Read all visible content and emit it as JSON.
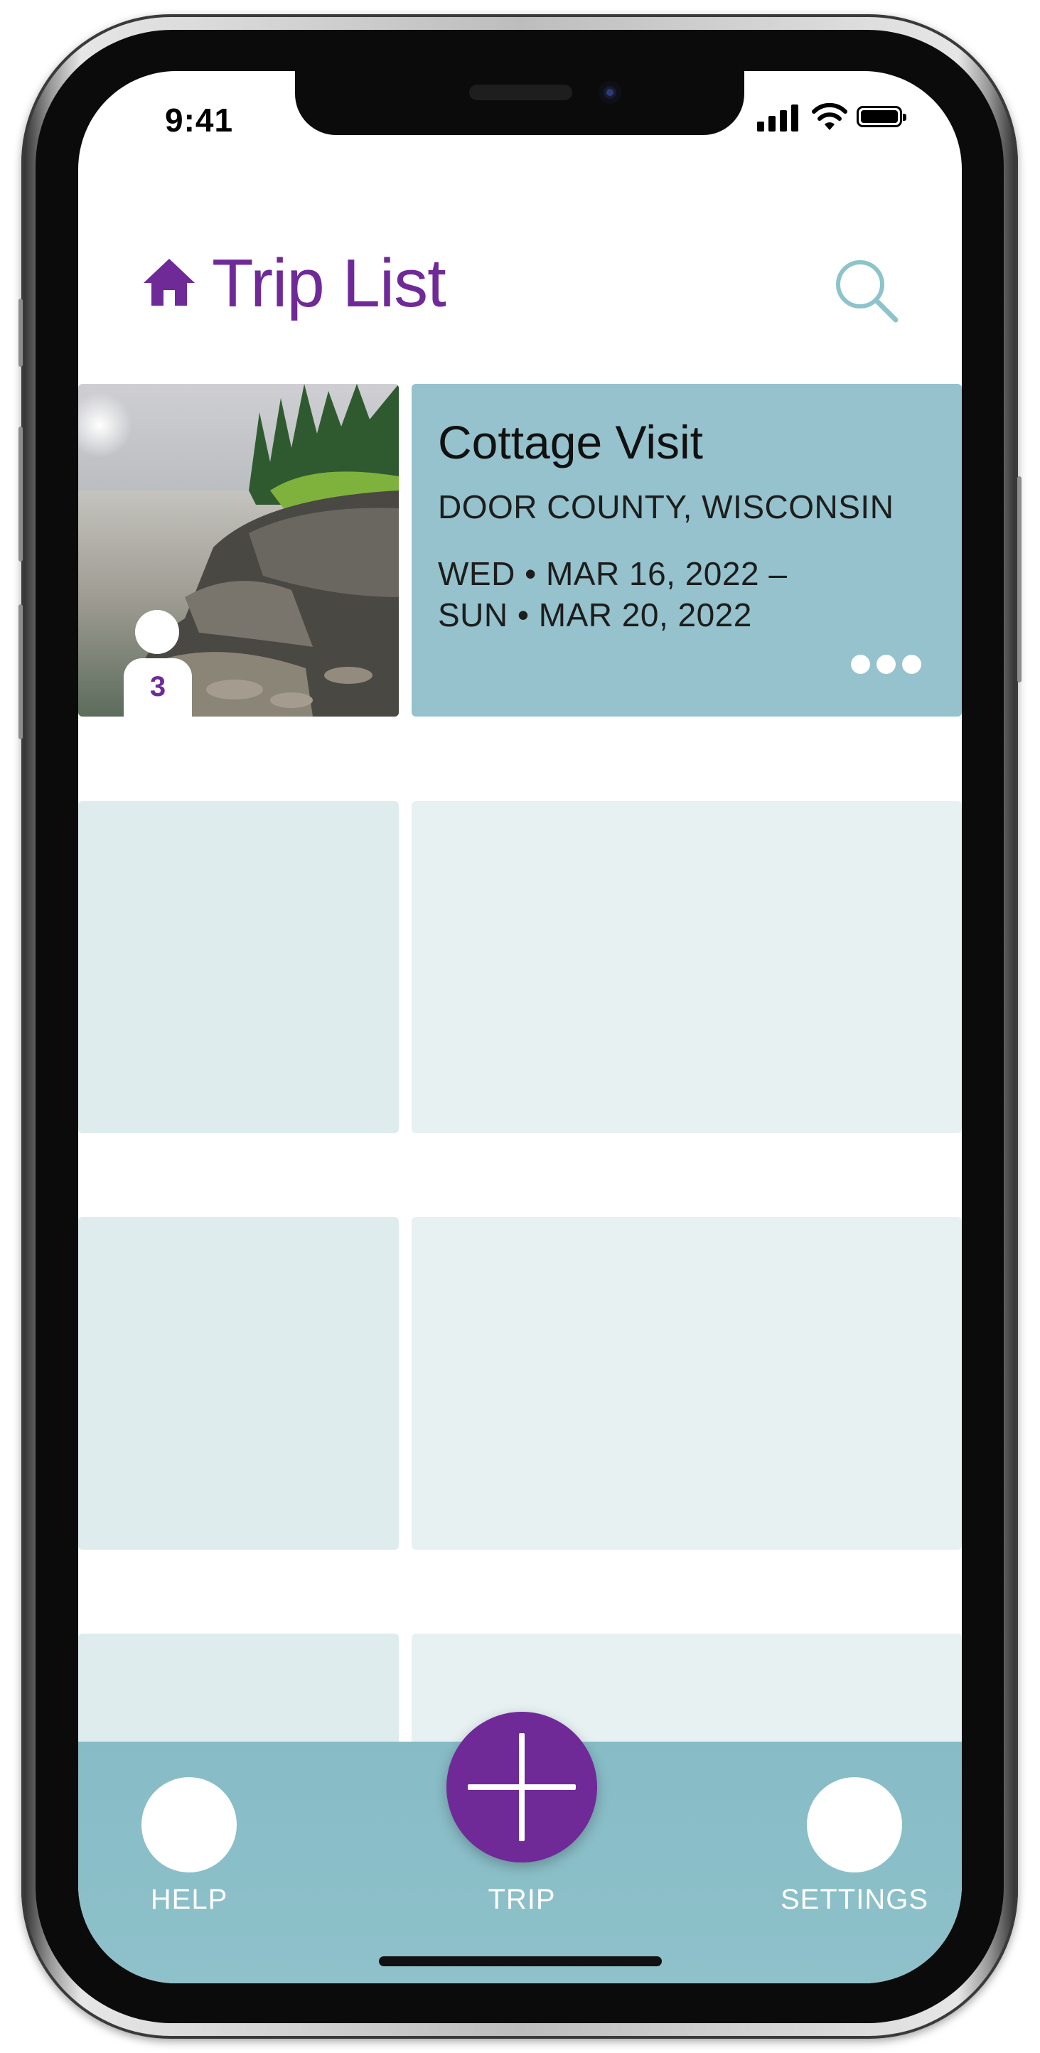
{
  "status_bar": {
    "time": "9:41",
    "icons": [
      "signal-icon",
      "wifi-icon",
      "battery-icon"
    ]
  },
  "header": {
    "title": "Trip List",
    "icons": [
      "home-icon",
      "search-icon"
    ]
  },
  "trips": [
    {
      "title": "Cottage Visit",
      "location": "DOOR COUNTY, WISCONSIN",
      "date_start": "WED • MAR 16, 2022 –",
      "date_end": "SUN • MAR 20, 2022",
      "traveler_count": "3",
      "image": "lakeshore-rocks-photo"
    }
  ],
  "bottom_nav": {
    "help_label": "HELP",
    "trip_label": "TRIP",
    "settings_label": "SETTINGS"
  },
  "colors": {
    "brand_purple": "#6f2a98",
    "card_teal": "#95c2cc",
    "nav_teal": "#87bcc6",
    "placeholder_left": "#deeced",
    "placeholder_right": "#e7f1f2",
    "search_icon": "#8dc3cb"
  }
}
